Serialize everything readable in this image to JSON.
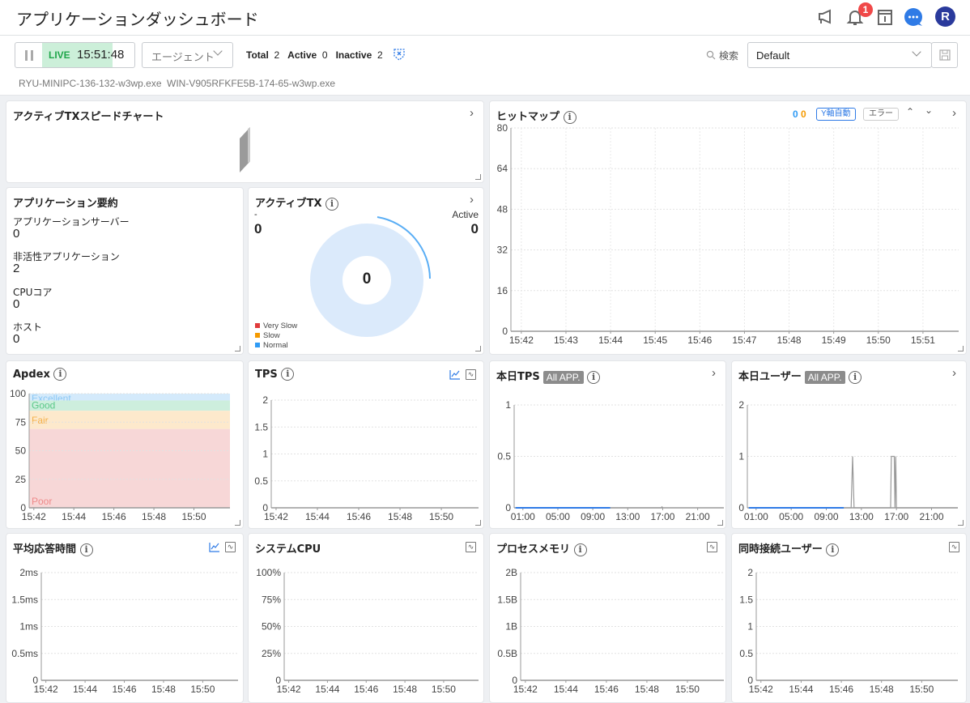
{
  "header": {
    "title": "アプリケーションダッシュボード",
    "notification_count": "1",
    "avatar_letter": "R",
    "icons": [
      "megaphone-icon",
      "bell-icon",
      "info-book-icon",
      "chat-icon"
    ]
  },
  "toolbar": {
    "live_label": "LIVE",
    "live_time": "15:51:48",
    "agent_dropdown": "エージェント",
    "total_label": "Total",
    "total_value": "2",
    "active_label": "Active",
    "active_value": "0",
    "inactive_label": "Inactive",
    "inactive_value": "2",
    "search_label": "検索",
    "preset_value": "Default",
    "agents": [
      "RYU-MINIPC-136-132-w3wp.exe",
      "WIN-V905RFKFE5B-174-65-w3wp.exe"
    ]
  },
  "panels": {
    "speed": {
      "title": "アクティブTXスピードチャート"
    },
    "heatmap": {
      "title": "ヒットマップ",
      "count_blue": "0",
      "count_orange": "0",
      "yaxis_button": "Y軸自動",
      "error_button": "エラー"
    },
    "summary": {
      "title": "アプリケーション要約",
      "items": [
        {
          "label": "アプリケーションサーバー",
          "value": "0"
        },
        {
          "label": "非活性アプリケーション",
          "value": "2"
        },
        {
          "label": "CPUコア",
          "value": "0"
        },
        {
          "label": "ホスト",
          "value": "0"
        }
      ]
    },
    "active_tx": {
      "title": "アクティブTX",
      "left_label": "-",
      "left_value": "0",
      "right_label": "Active",
      "right_value": "0",
      "center_value": "0",
      "legend": [
        {
          "label": "Very Slow",
          "color": "#e03b3b"
        },
        {
          "label": "Slow",
          "color": "#f59a00"
        },
        {
          "label": "Normal",
          "color": "#2f9bf5"
        }
      ]
    },
    "apdex": {
      "title": "Apdex"
    },
    "tps": {
      "title": "TPS"
    },
    "today_tps": {
      "title": "本日TPS",
      "badge": "All APP."
    },
    "today_users": {
      "title": "本日ユーザー",
      "badge": "All APP."
    },
    "avg_resp": {
      "title": "平均応答時間"
    },
    "sys_cpu": {
      "title": "システムCPU"
    },
    "proc_mem": {
      "title": "プロセスメモリ"
    },
    "concurrent": {
      "title": "同時接続ユーザー"
    }
  },
  "colors": {
    "accent": "#2f7be6",
    "live_bg": "#ccefd9",
    "live_text": "#1fa64a",
    "badge_red": "#f04848",
    "avatar": "#2a3a9c"
  },
  "chart_data": [
    {
      "type": "heatmap",
      "ylim": [
        0,
        80
      ],
      "yticks": [
        0,
        16,
        32,
        48,
        64,
        80
      ],
      "yticklabels": [
        "0",
        "16",
        "32",
        "48",
        "64",
        "80"
      ],
      "xlim": [
        "15:41:46",
        "15:51:48"
      ],
      "xticks": [
        "15:42",
        "15:43",
        "15:44",
        "15:45",
        "15:46",
        "15:47",
        "15:48",
        "15:49",
        "15:50",
        "15:51"
      ],
      "grid": true,
      "series": []
    },
    {
      "type": "area",
      "ylim": [
        0,
        100
      ],
      "yticks": [
        0,
        25,
        50,
        75,
        100
      ],
      "yticklabels": [
        "0",
        "25",
        "50",
        "75",
        "100"
      ],
      "xlim": [
        "15:41:46",
        "15:51:48"
      ],
      "xticks": [
        "15:42",
        "15:44",
        "15:46",
        "15:48",
        "15:50"
      ],
      "bands": [
        {
          "label": "Excellent",
          "from": 94,
          "to": 100,
          "color": "#d4eafb",
          "text": "#8cc8f5"
        },
        {
          "label": "Good",
          "from": 85,
          "to": 94,
          "color": "#cdeedd",
          "text": "#5cc98a"
        },
        {
          "label": "Fair",
          "from": 69,
          "to": 85,
          "color": "#fde9cc",
          "text": "#f5b14a"
        },
        {
          "label": "Poor",
          "from": 0,
          "to": 69,
          "color": "#f7d7d7",
          "text": "#ee8a8a"
        }
      ],
      "series": []
    },
    {
      "type": "line",
      "ylim": [
        0,
        2
      ],
      "yticks": [
        0,
        0.5,
        1,
        1.5,
        2
      ],
      "yticklabels": [
        "0",
        "0.5",
        "1",
        "1.5",
        "2"
      ],
      "xlim": [
        "15:41:46",
        "15:51:48"
      ],
      "xticks": [
        "15:42",
        "15:44",
        "15:46",
        "15:48",
        "15:50"
      ],
      "series": []
    },
    {
      "type": "line",
      "ylim": [
        0,
        1
      ],
      "yticks": [
        0,
        0.5,
        1
      ],
      "yticklabels": [
        "0",
        "0.5",
        "1"
      ],
      "xlim": [
        "00:00",
        "24:00"
      ],
      "xticks": [
        "01:00",
        "05:00",
        "09:00",
        "13:00",
        "17:00",
        "21:00"
      ],
      "series": [
        {
          "color": "#2f7be6",
          "points": [
            [
              "00:10",
              0
            ],
            [
              "11:00",
              0
            ]
          ]
        },
        {
          "color": "#999999",
          "points": [
            [
              "11:00",
              0
            ],
            [
              "16:50",
              0
            ],
            [
              "16:55",
              0.01
            ],
            [
              "17:00",
              0
            ]
          ]
        }
      ]
    },
    {
      "type": "line",
      "ylim": [
        0,
        2
      ],
      "yticks": [
        0,
        1,
        2
      ],
      "yticklabels": [
        "0",
        "1",
        "2"
      ],
      "xlim": [
        "00:00",
        "24:00"
      ],
      "xticks": [
        "01:00",
        "05:00",
        "09:00",
        "13:00",
        "17:00",
        "21:00"
      ],
      "series": [
        {
          "color": "#2f7be6",
          "points": [
            [
              "00:10",
              0
            ],
            [
              "11:00",
              0
            ]
          ]
        },
        {
          "color": "#999999",
          "points": [
            [
              "11:00",
              0
            ],
            [
              "11:50",
              0
            ],
            [
              "12:00",
              1
            ],
            [
              "12:10",
              0
            ],
            [
              "16:20",
              0
            ],
            [
              "16:25",
              1
            ],
            [
              "16:45",
              1
            ],
            [
              "16:50",
              0
            ],
            [
              "16:55",
              1
            ],
            [
              "17:00",
              0
            ],
            [
              "24:00",
              0
            ]
          ]
        }
      ]
    },
    {
      "type": "line",
      "ylim": [
        0,
        2
      ],
      "yticks": [
        0,
        0.5,
        1,
        1.5,
        2
      ],
      "yticklabels": [
        "0",
        "0.5ms",
        "1ms",
        "1.5ms",
        "2ms"
      ],
      "xlim": [
        "15:41:46",
        "15:51:48"
      ],
      "xticks": [
        "15:42",
        "15:44",
        "15:46",
        "15:48",
        "15:50"
      ],
      "series": []
    },
    {
      "type": "line",
      "ylim": [
        0,
        100
      ],
      "yticks": [
        0,
        25,
        50,
        75,
        100
      ],
      "yticklabels": [
        "0",
        "25%",
        "50%",
        "75%",
        "100%"
      ],
      "xlim": [
        "15:41:46",
        "15:51:48"
      ],
      "xticks": [
        "15:42",
        "15:44",
        "15:46",
        "15:48",
        "15:50"
      ],
      "series": []
    },
    {
      "type": "line",
      "ylim": [
        0,
        2
      ],
      "yticks": [
        0,
        0.5,
        1,
        1.5,
        2
      ],
      "yticklabels": [
        "0",
        "0.5B",
        "1B",
        "1.5B",
        "2B"
      ],
      "xlim": [
        "15:41:46",
        "15:51:48"
      ],
      "xticks": [
        "15:42",
        "15:44",
        "15:46",
        "15:48",
        "15:50"
      ],
      "series": []
    },
    {
      "type": "line",
      "ylim": [
        0,
        2
      ],
      "yticks": [
        0,
        0.5,
        1,
        1.5,
        2
      ],
      "yticklabels": [
        "0",
        "0.5",
        "1",
        "1.5",
        "2"
      ],
      "xlim": [
        "15:41:46",
        "15:51:48"
      ],
      "xticks": [
        "15:42",
        "15:44",
        "15:46",
        "15:48",
        "15:50"
      ],
      "series": []
    }
  ]
}
